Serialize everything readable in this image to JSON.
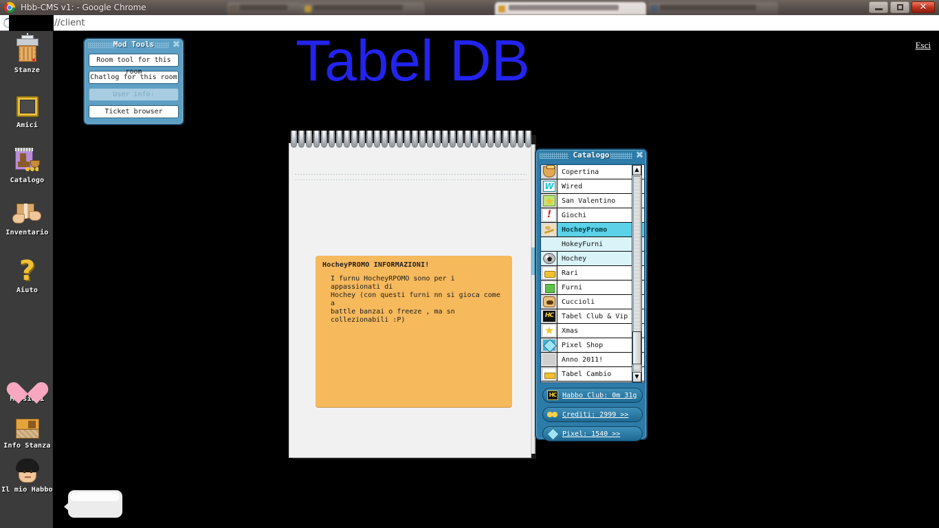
{
  "browser": {
    "window_title": "Hbb-CMS v1: - Google Chrome",
    "url_text": "//client",
    "url_redacted": true,
    "controls": {
      "minimize": "–",
      "maximize": "□",
      "close": "✕"
    },
    "tabs": [
      {
        "label": "",
        "active": false
      },
      {
        "label": "",
        "active": false
      },
      {
        "label": "",
        "active": true
      },
      {
        "label": "",
        "active": false
      }
    ]
  },
  "page": {
    "title": "Tabel DB",
    "title_color": "#2323ee",
    "logout_label": "Esci"
  },
  "sidebar": {
    "items": [
      {
        "label": "Stanze",
        "icon": "tower-icon"
      },
      {
        "label": "Amici",
        "icon": "frame-icon"
      },
      {
        "label": "Catalogo",
        "icon": "catalog-icon"
      },
      {
        "label": "Inventario",
        "icon": "inventory-hand-icon"
      },
      {
        "label": "Aiuto",
        "icon": "question-mark-icon"
      },
      {
        "label": "Missioni",
        "icon": "heart-icon"
      },
      {
        "label": "Info Stanza",
        "icon": "room-icon"
      },
      {
        "label": "Il mio Habbo",
        "icon": "avatar-face-icon"
      }
    ]
  },
  "mod_tools": {
    "title": "Mod Tools",
    "close_glyph": "✖",
    "buttons": [
      {
        "label": "Room tool for this room",
        "disabled": false
      },
      {
        "label": "Chatlog for this room",
        "disabled": false
      },
      {
        "label": "User info:",
        "disabled": true
      },
      {
        "label": "Ticket browser",
        "disabled": false
      }
    ]
  },
  "notepad": {
    "note_title": "HocheyPROMO INFORMAZIONI!",
    "note_lines": [
      "I furnu HocheyRPOMO sono per i appassionati di",
      "Hochey (con questi furni nn si gioca come a",
      "battle banzai o freeze , ma sn collezionabili :P)"
    ],
    "note_color": "#f6b95c"
  },
  "catalog": {
    "title": "Catalogo",
    "close_glyph": "✖",
    "rows": [
      {
        "label": "Copertina",
        "icon": "pot-icon",
        "arrow": "",
        "state": "normal"
      },
      {
        "label": "Wired",
        "icon": "wired-w-icon",
        "arrow": "▶",
        "state": "normal"
      },
      {
        "label": "San Valentino",
        "icon": "star-icon",
        "arrow": "▶",
        "state": "normal"
      },
      {
        "label": "Giochi",
        "icon": "exclamation-icon",
        "arrow": "▶",
        "state": "normal"
      },
      {
        "label": "HocheyPromo",
        "icon": "hockey-stick-icon",
        "arrow": "▼",
        "state": "selected"
      },
      {
        "label": "HokeyFurni",
        "icon": "",
        "arrow": "",
        "state": "child"
      },
      {
        "label": "Hochey",
        "icon": "ball-icon",
        "arrow": "",
        "state": "child"
      },
      {
        "label": "Rari",
        "icon": "rare-icon",
        "arrow": "▶",
        "state": "normal"
      },
      {
        "label": "Furni",
        "icon": "furni-chair-icon",
        "arrow": "▶",
        "state": "normal"
      },
      {
        "label": "Cuccioli",
        "icon": "pet-icon",
        "arrow": "▶",
        "state": "normal"
      },
      {
        "label": "Tabel Club & Vip",
        "icon": "hc-badge-icon",
        "arrow": "▶",
        "state": "normal"
      },
      {
        "label": "Xmas",
        "icon": "xmas-star-icon",
        "arrow": "▶",
        "state": "normal"
      },
      {
        "label": "Pixel Shop",
        "icon": "pixel-cube-icon",
        "arrow": "▶",
        "state": "normal"
      },
      {
        "label": "Anno 2011!",
        "icon": "blank-icon",
        "arrow": "▶",
        "state": "normal"
      },
      {
        "label": "Tabel Cambio",
        "icon": "gold-icon",
        "arrow": "",
        "state": "normal"
      }
    ],
    "scroll": {
      "up_glyph": "▲",
      "down_glyph": "▼"
    },
    "currency": [
      {
        "label": "Habbo Club: 0m 31g",
        "icon": "hc-badge-icon"
      },
      {
        "label": "Crediti: 2999 >>",
        "icon": "coins-icon"
      },
      {
        "label": "Pixel: 1540 >>",
        "icon": "pixel-cube-icon"
      }
    ]
  },
  "chat": {
    "bubble_text": ""
  }
}
